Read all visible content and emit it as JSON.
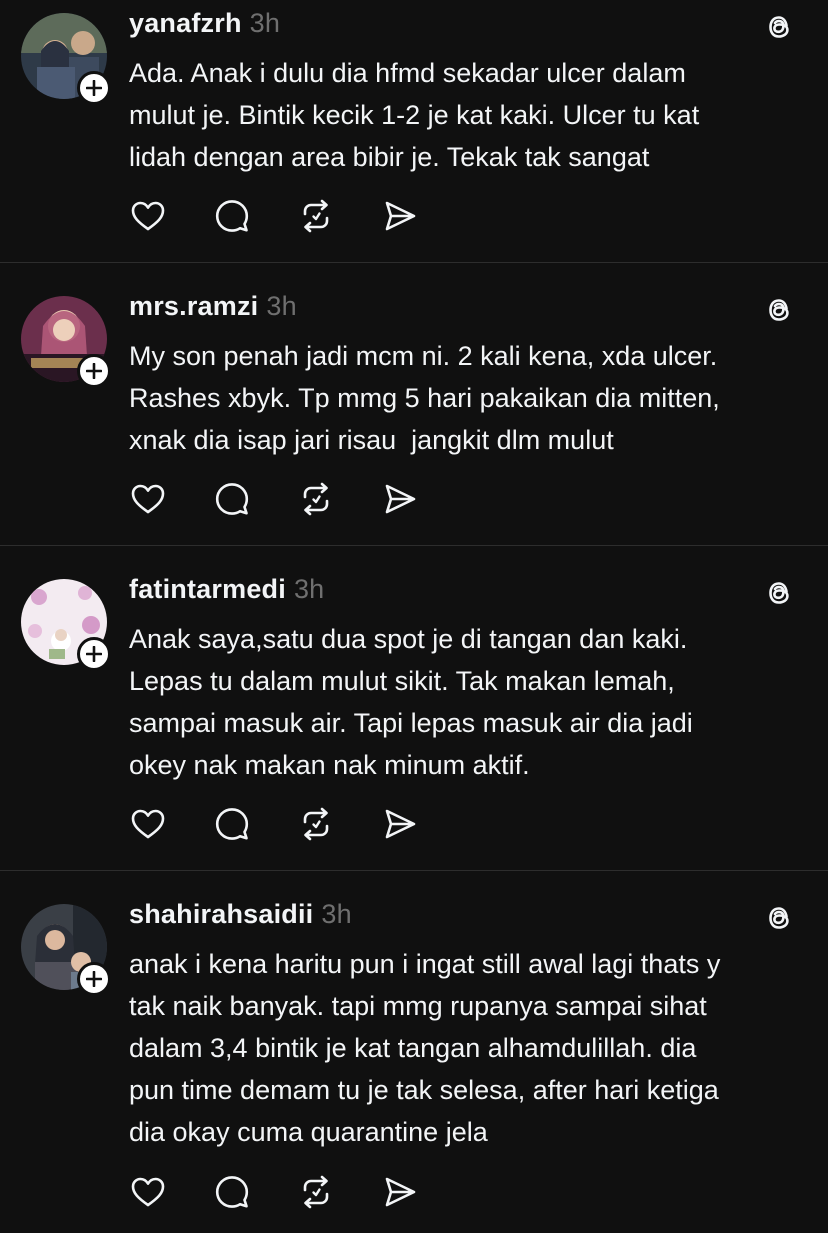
{
  "posts": [
    {
      "username": "yanafzrh",
      "time": "3h",
      "text": "Ada. Anak i dulu dia hfmd sekadar ulcer dalam\nmulut je. Bintik kecik 1-2 je kat kaki. Ulcer tu kat\nlidah dengan area bibir je. Tekak tak sangat",
      "avatar_colors": [
        "#3b4a5e",
        "#7a6a55",
        "#c9a88a"
      ]
    },
    {
      "username": "mrs.ramzi",
      "time": "3h",
      "text": "My son penah jadi mcm ni. 2 kali kena, xda ulcer.\nRashes xbyk. Tp mmg 5 hari pakaikan dia mitten,\nxnak dia isap jari risau  jangkit dlm mulut",
      "avatar_colors": [
        "#5a2a4a",
        "#b25a7a",
        "#e8c7b0"
      ]
    },
    {
      "username": "fatintarmedi",
      "time": "3h",
      "text": "Anak saya,satu dua spot je di tangan dan kaki.\nLepas tu dalam mulut sikit. Tak makan lemah,\nsampai masuk air. Tapi lepas masuk air dia jadi\nokey nak makan nak minum aktif.",
      "avatar_colors": [
        "#f1e6ef",
        "#d49ac8",
        "#9fb88a"
      ]
    },
    {
      "username": "shahirahsaidii",
      "time": "3h",
      "text": "anak i kena haritu pun i ingat still awal lagi thats y\ntak naik banyak. tapi mmg rupanya sampai sihat\ndalam 3,4 bintik je kat tangan alhamdulillah. dia\npun time demam tu je tak selesa, after hari ketiga\ndia okay cuma quarantine jela",
      "avatar_colors": [
        "#4a4a4a",
        "#2c3440",
        "#d8b49a"
      ]
    }
  ],
  "icons": {
    "like": "heart-icon",
    "reply": "comment-icon",
    "repost": "repost-icon",
    "share": "send-icon",
    "threads": "threads-logo-icon",
    "follow": "plus-icon"
  },
  "colors": {
    "background": "#101010",
    "text": "#f3f5f7",
    "muted": "#6f6f6f",
    "divider": "#2d2d2d"
  }
}
